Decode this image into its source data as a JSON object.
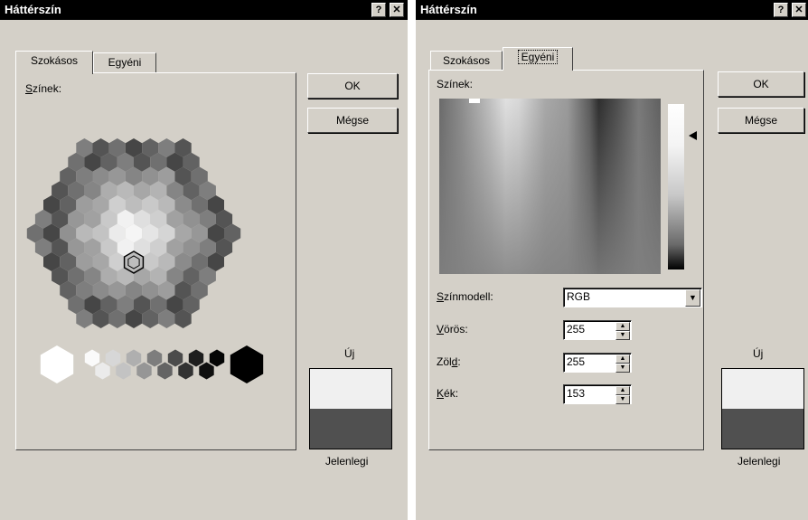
{
  "left_dialog": {
    "title": "Háttérszín",
    "help_button": "?",
    "close_button": "✕",
    "tabs": [
      {
        "label": "Szokásos",
        "active": true
      },
      {
        "label": "Egyéni",
        "active": false
      }
    ],
    "colors_label": "Színek:",
    "ok_label": "OK",
    "cancel_label": "Mégse",
    "new_label": "Új",
    "current_label": "Jelenlegi",
    "new_color": "#f0f0f0",
    "current_color": "#505050"
  },
  "right_dialog": {
    "title": "Háttérszín",
    "help_button": "?",
    "close_button": "✕",
    "tabs": [
      {
        "label": "Szokásos",
        "active": false
      },
      {
        "label": "Egyéni",
        "active": true
      }
    ],
    "colors_label": "Színek:",
    "color_model_label": "Színmodell:",
    "color_model_value": "RGB",
    "red_label": "Vörös:",
    "red_value": "255",
    "green_label": "Zöld:",
    "green_value": "255",
    "blue_label": "Kék:",
    "blue_value": "153",
    "ok_label": "OK",
    "cancel_label": "Mégse",
    "new_label": "Új",
    "current_label": "Jelenlegi",
    "new_color": "#f0f0f0",
    "current_color": "#505050"
  }
}
